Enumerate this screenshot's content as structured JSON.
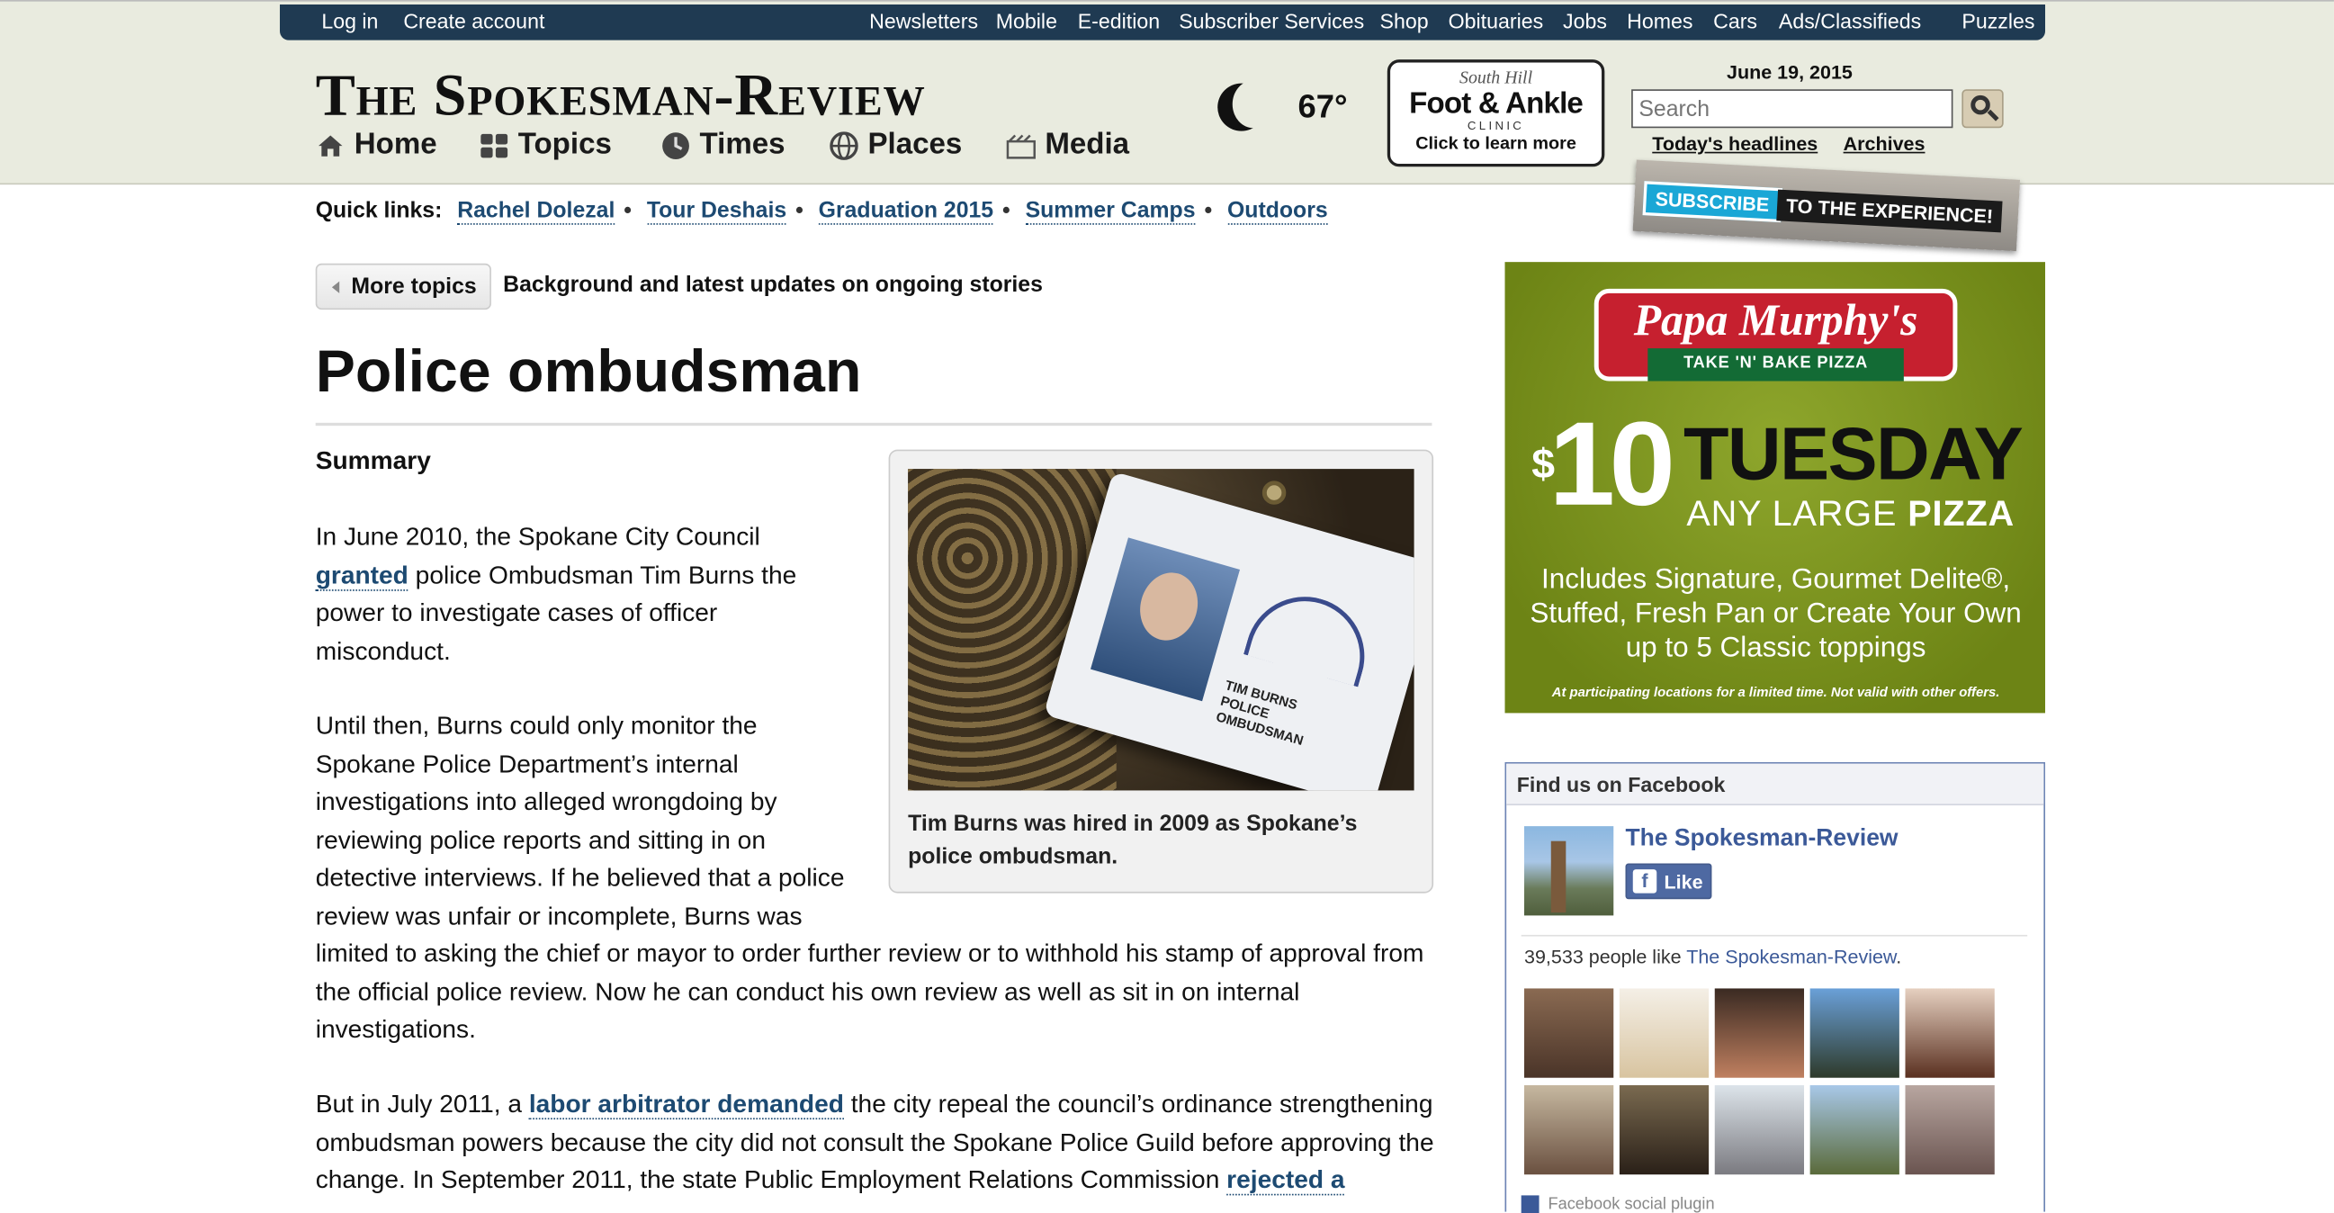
{
  "topbar": {
    "left": [
      "Log in",
      "Create account"
    ],
    "right": [
      "Newsletters",
      "Mobile",
      "E-edition",
      "Subscriber Services",
      "Shop",
      "Obituaries",
      "Jobs",
      "Homes",
      "Cars",
      "Ads/Classifieds",
      "Puzzles"
    ]
  },
  "masthead": "The Spokesman-Review",
  "nav": [
    "Home",
    "Topics",
    "Times",
    "Places",
    "Media"
  ],
  "weather": {
    "temp": "67°",
    "icon": "moon-icon"
  },
  "foot_ad": {
    "line1": "South Hill",
    "line2": "Foot & Ankle",
    "line3": "CLINIC",
    "line4": "Click to learn more"
  },
  "date": "June 19, 2015",
  "search": {
    "placeholder": "Search"
  },
  "header_links": [
    "Today's headlines",
    "Archives"
  ],
  "subscribe": {
    "left": "SUBSCRIBE",
    "right": "TO THE EXPERIENCE!"
  },
  "quicklinks": {
    "label": "Quick links:",
    "items": [
      "Rachel Dolezal",
      "Tour Deshais",
      "Graduation 2015",
      "Summer Camps",
      "Outdoors"
    ]
  },
  "more_topics": {
    "button": "More topics",
    "desc": "Background and latest updates on ongoing stories"
  },
  "article": {
    "title": "Police ombudsman",
    "summary_heading": "Summary",
    "p1": {
      "pre": "In June 2010, the Spokane City Council",
      "link": "granted",
      "post1": "police Ombudsman Tim Burns the",
      "line3": "power to investigate cases of officer",
      "line4": "misconduct."
    },
    "p2": [
      "Until then, Burns could only monitor the",
      "Spokane Police Department’s internal",
      "investigations into alleged wrongdoing by",
      "reviewing police reports and sitting in on",
      "detective interviews. If he believed that a police",
      "review was unfair or incomplete, Burns was",
      "limited to asking the chief or mayor to order further review or to withhold his stamp of approval from",
      "the official police review. Now he can conduct his own review as well as sit in on internal",
      "investigations."
    ],
    "p3": {
      "pre": "But in July 2011, a",
      "link1": "labor arbitrator demanded",
      "post1": "the city repeal the council’s ordinance strengthening",
      "line2": "ombudsman powers because the city did not consult the Spokane Police Guild before approving the",
      "line3pre": "change. In September 2011, the state Public Employment Relations Commission",
      "link2": "rejected a"
    },
    "photo_caption": "Tim Burns was hired in 2009 as Spokane’s police ombudsman.",
    "badge_text": "TIM BURNS POLICE OMBUDSMAN"
  },
  "ad_papa": {
    "brand": "Papa Murphy's",
    "tagline": "TAKE 'N' BAKE PIZZA",
    "price": "10",
    "currency": "$",
    "day": "TUESDAY",
    "any_large": "ANY LARGE",
    "pizza": "PIZZA",
    "desc": "Includes Signature, Gourmet Delite®, Stuffed, Fresh Pan or Create Your Own up to 5 Classic toppings",
    "fine": "At participating locations for a limited time. Not valid with other offers."
  },
  "facebook": {
    "heading": "Find us on Facebook",
    "page_name": "The Spokesman-Review",
    "like": "Like",
    "count_pre": "39,533 people like",
    "count_name": "The Spokesman-Review",
    "count_post": ".",
    "footer": "Facebook social plugin"
  }
}
